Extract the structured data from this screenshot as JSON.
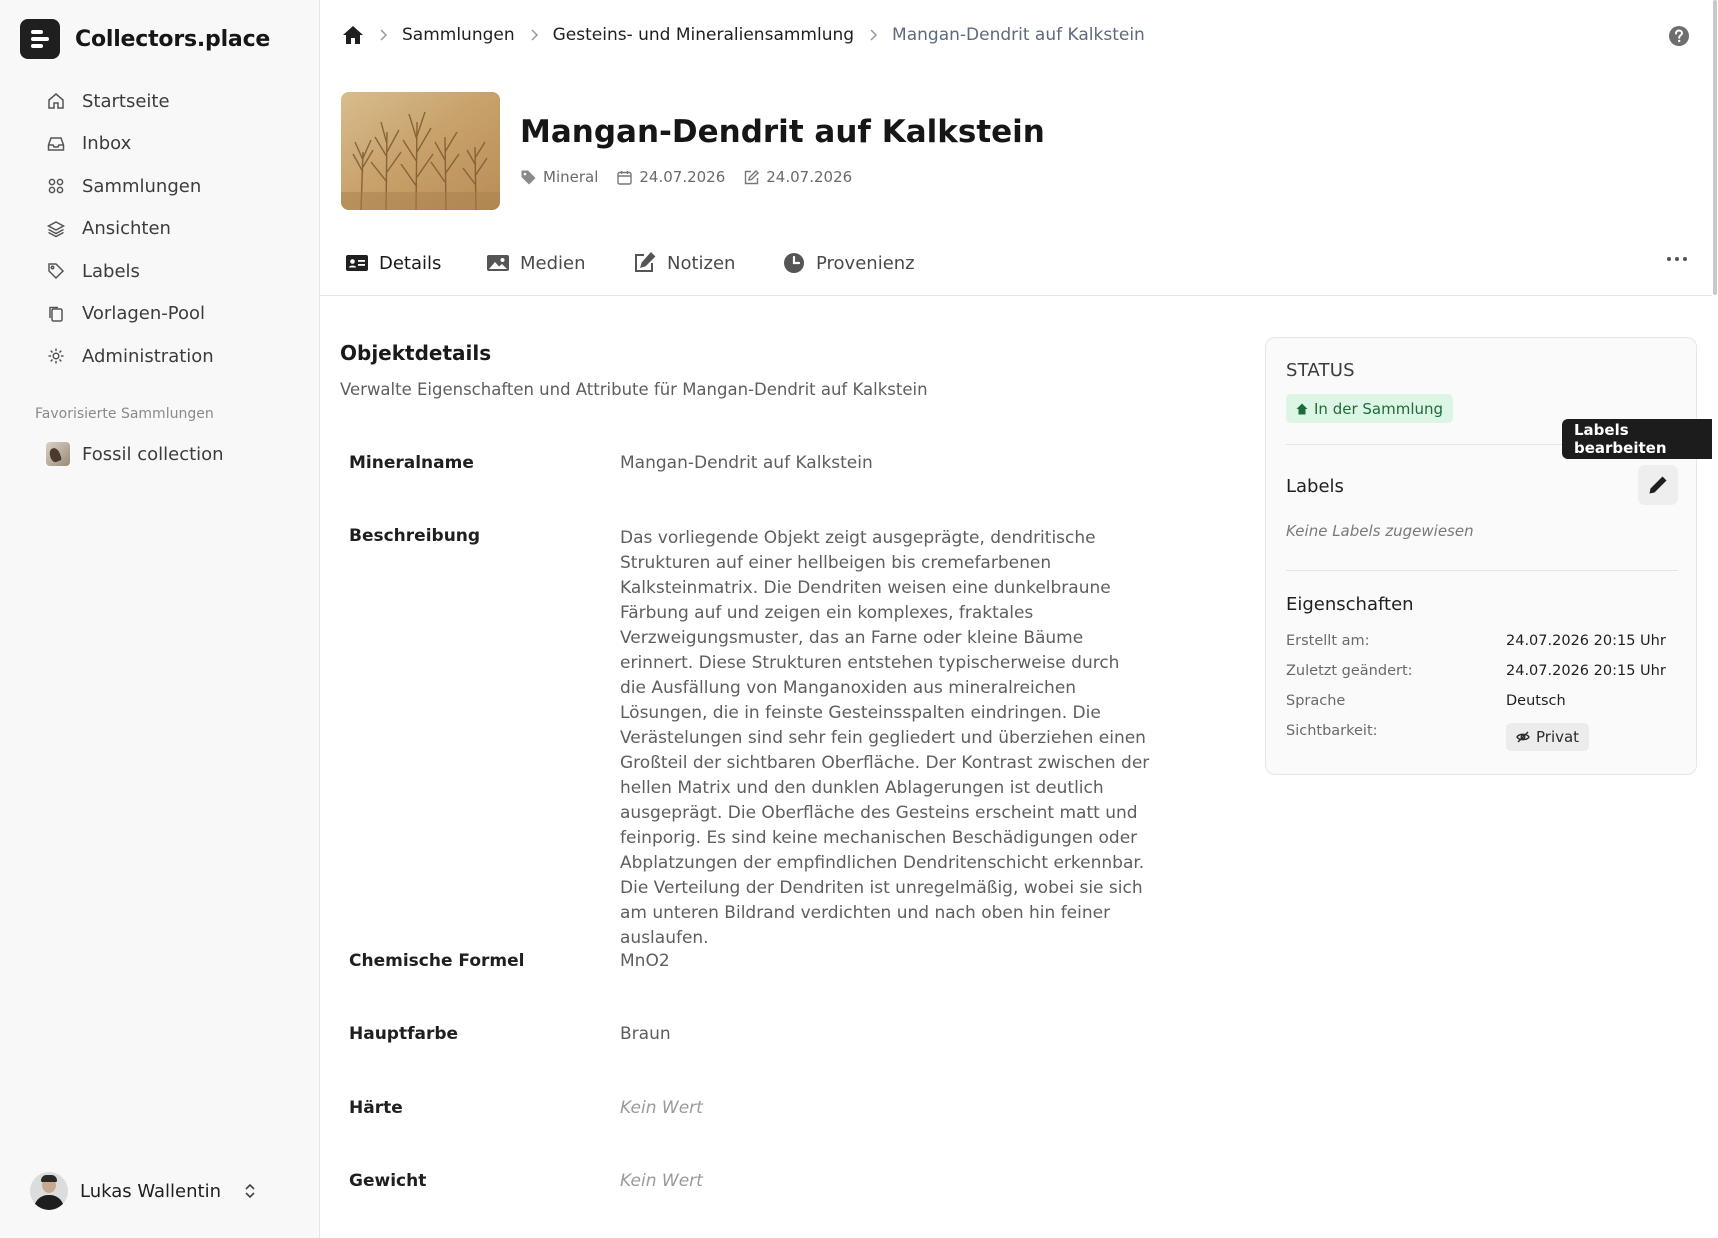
{
  "brand": {
    "name": "Collectors.place"
  },
  "sidebar": {
    "items": [
      {
        "label": "Startseite",
        "icon": "home-icon"
      },
      {
        "label": "Inbox",
        "icon": "inbox-icon"
      },
      {
        "label": "Sammlungen",
        "icon": "grid-icon"
      },
      {
        "label": "Ansichten",
        "icon": "layers-icon"
      },
      {
        "label": "Labels",
        "icon": "tag-icon"
      },
      {
        "label": "Vorlagen-Pool",
        "icon": "copy-icon"
      },
      {
        "label": "Administration",
        "icon": "gear-icon"
      }
    ],
    "favorites_heading": "Favorisierte Sammlungen",
    "favorites": [
      {
        "label": "Fossil collection"
      }
    ]
  },
  "user": {
    "name": "Lukas Wallentin"
  },
  "breadcrumb": {
    "items": [
      "Sammlungen",
      "Gesteins- und Mineraliensammlung"
    ],
    "current": "Mangan-Dendrit auf Kalkstein"
  },
  "object": {
    "title": "Mangan-Dendrit auf Kalkstein",
    "type": "Mineral",
    "created": "24.07.2026",
    "modified": "24.07.2026"
  },
  "tabs": [
    {
      "label": "Details",
      "icon": "id-card-icon",
      "active": true
    },
    {
      "label": "Medien",
      "icon": "image-icon",
      "active": false
    },
    {
      "label": "Notizen",
      "icon": "edit-icon",
      "active": false
    },
    {
      "label": "Provenienz",
      "icon": "clock-icon",
      "active": false
    }
  ],
  "details": {
    "title": "Objektdetails",
    "subtitle": "Verwalte Eigenschaften und Attribute für Mangan-Dendrit auf Kalkstein",
    "fields": [
      {
        "label": "Mineralname",
        "value": "Mangan-Dendrit auf Kalkstein"
      },
      {
        "label": "Beschreibung",
        "value": "Das vorliegende Objekt zeigt ausgeprägte, dendritische Strukturen auf einer hellbeigen bis cremefarbenen Kalksteinmatrix. Die Dendriten weisen eine dunkelbraune Färbung auf und zeigen ein komplexes, fraktales Verzweigungsmuster, das an Farne oder kleine Bäume erinnert. Diese Strukturen entstehen typischerweise durch die Ausfällung von Manganoxiden aus mineralreichen Lösungen, die in feinste Gesteinsspalten eindringen. Die Verästelungen sind sehr fein gegliedert und überziehen einen Großteil der sichtbaren Oberfläche. Der Kontrast zwischen der hellen Matrix und den dunklen Ablagerungen ist deutlich ausgeprägt. Die Oberfläche des Gesteins erscheint matt und feinporig. Es sind keine mechanischen Beschädigungen oder Abplatzungen der empfindlichen Dendritenschicht erkennbar. Die Verteilung der Dendriten ist unregelmäßig, wobei sie sich am unteren Bildrand verdichten und nach oben hin feiner auslaufen."
      },
      {
        "label": "Chemische Formel",
        "value": "MnO2"
      },
      {
        "label": "Hauptfarbe",
        "value": "Braun"
      },
      {
        "label": "Härte",
        "value": "Kein Wert"
      },
      {
        "label": "Gewicht",
        "value": "Kein Wert"
      }
    ]
  },
  "panel": {
    "status_label": "STATUS",
    "status_value": "In der Sammlung",
    "status_color": "#1e6b3a",
    "labels_title": "Labels",
    "labels_empty": "Keine Labels zugewiesen",
    "edit_tooltip": "Labels bearbeiten",
    "props_title": "Eigenschaften",
    "props": [
      {
        "key": "Erstellt am:",
        "value": "24.07.2026 20:15 Uhr"
      },
      {
        "key": "Zuletzt geändert:",
        "value": "24.07.2026 20:15 Uhr"
      },
      {
        "key": "Sprache",
        "value": "Deutsch"
      },
      {
        "key": "Sichtbarkeit:",
        "value": "Privat"
      }
    ]
  }
}
